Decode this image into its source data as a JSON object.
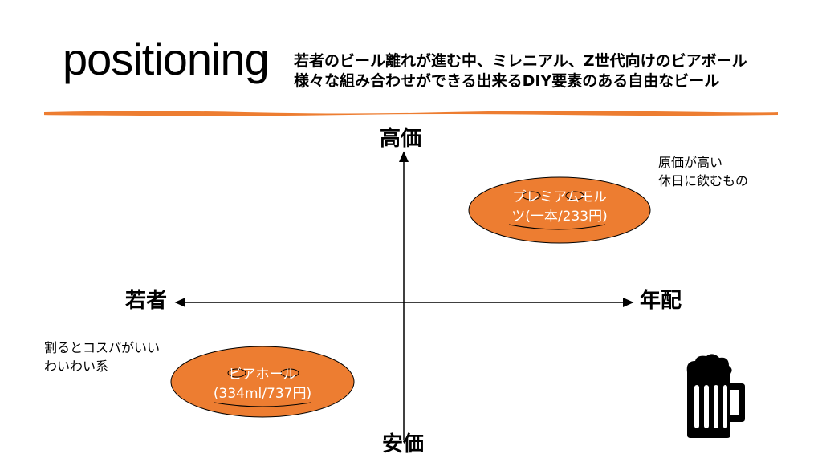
{
  "header": {
    "title": "positioning",
    "subtitle_line1": "若者のビール離れが進む中、ミレニアル、Z世代向けのビアボール",
    "subtitle_line2": "様々な組み合わせができる出来るDIY要素のある自由なビール"
  },
  "axes": {
    "top": "高価",
    "bottom": "安価",
    "left": "若者",
    "right": "年配"
  },
  "items": [
    {
      "line1": "プレミアムモル",
      "line2": "ツ(一本/233円)",
      "note_line1": "原価が高い",
      "note_line2": "休日に飲むもの"
    },
    {
      "line1": "ビアホール",
      "line2": "(334ml/737円)",
      "note_line1": "割るとコスパがいい",
      "note_line2": "わいわい系"
    }
  ],
  "colors": {
    "accent": "#ED7D31",
    "bubble_stroke": "#000000",
    "text": "#000000"
  },
  "icons": {
    "beer": "beer-mug-icon"
  }
}
